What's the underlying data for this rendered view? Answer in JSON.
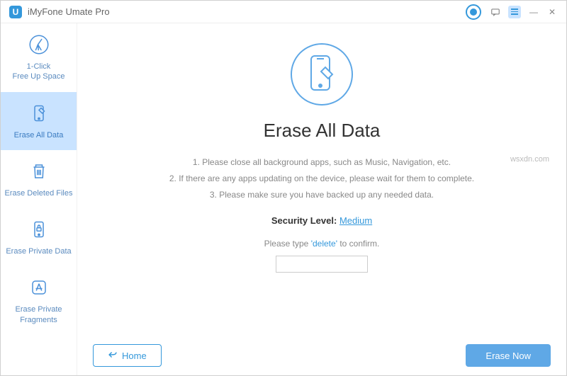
{
  "titlebar": {
    "app_logo_letter": "U",
    "app_title": "iMyFone Umate Pro"
  },
  "sidebar": {
    "items": [
      {
        "label": "1-Click\nFree Up Space"
      },
      {
        "label": "Erase All Data"
      },
      {
        "label": "Erase Deleted Files"
      },
      {
        "label": "Erase Private Data"
      },
      {
        "label": "Erase Private\nFragments"
      }
    ]
  },
  "main": {
    "heading": "Erase All Data",
    "instructions": [
      "1. Please close all background apps, such as Music, Navigation, etc.",
      "2. If there are any apps updating on the device, please wait for them to complete.",
      "3. Please make sure you have backed up any needed data."
    ],
    "security_label": "Security Level:",
    "security_value": "Medium",
    "confirm_prefix": "Please type",
    "confirm_keyword": "'delete'",
    "confirm_suffix": "to confirm."
  },
  "footer": {
    "home_label": "Home",
    "erase_label": "Erase Now"
  },
  "watermark": "wsxdn.com"
}
